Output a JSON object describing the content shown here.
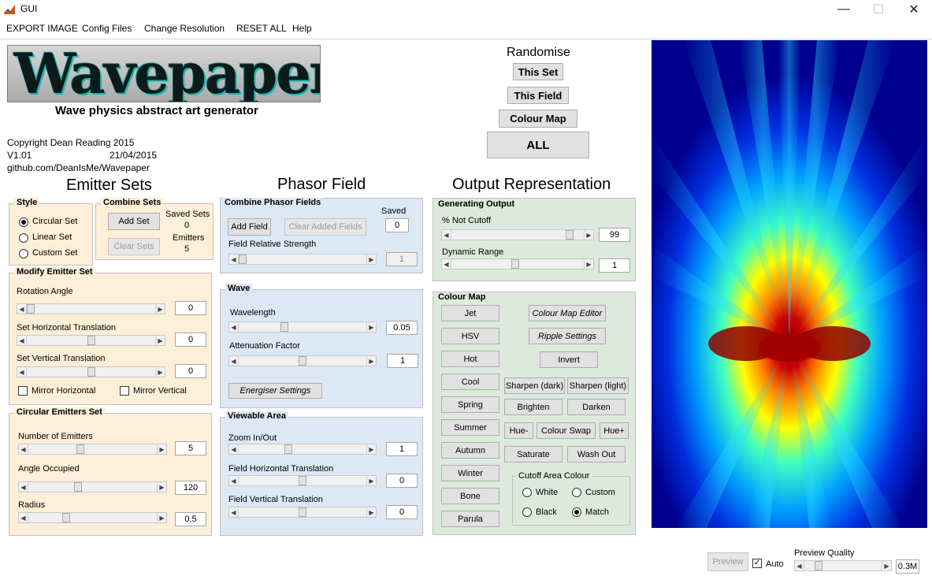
{
  "window": {
    "title": "GUI",
    "minimize": "—",
    "maximize": "☐",
    "close": "✕"
  },
  "menu": [
    "EXPORT IMAGE",
    "Config Files",
    "Change Resolution",
    "RESET ALL",
    "Help"
  ],
  "header": {
    "logo_text": "Wavepaper",
    "subtitle": "Wave physics abstract art generator",
    "copyright": "Copyright Dean Reading 2015",
    "version": "V1.01",
    "date": "21/04/2015",
    "url": "github.com/DeanIsMe/Wavepaper"
  },
  "randomise": {
    "title": "Randomise",
    "this_set": "This Set",
    "this_field": "This Field",
    "colour_map": "Colour Map",
    "all": "ALL"
  },
  "emitter": {
    "heading": "Emitter Sets",
    "style": {
      "title": "Style",
      "options": [
        "Circular Set",
        "Linear Set",
        "Custom Set"
      ],
      "selected": 0
    },
    "combine": {
      "title": "Combine Sets",
      "add_set": "Add Set",
      "clear_sets": "Clear Sets",
      "saved_label": "Saved Sets",
      "saved_value": "0",
      "emitters_label": "Emitters",
      "emitters_value": "5"
    },
    "modify": {
      "title": "Modify Emitter Set",
      "rotation_label": "Rotation Angle",
      "rotation_value": "0",
      "rotation_pos": 0.0,
      "htrans_label": "Set Horizontal Translation",
      "htrans_value": "0",
      "htrans_pos": 0.5,
      "vtrans_label": "Set Vertical Translation",
      "vtrans_value": "0",
      "vtrans_pos": 0.5,
      "mirror_h": "Mirror Horizontal",
      "mirror_v": "Mirror Vertical"
    },
    "circular": {
      "title": "Circular Emitters Set",
      "num_label": "Number of Emitters",
      "num_value": "5",
      "num_pos": 0.4,
      "angle_label": "Angle Occupied",
      "angle_value": "120",
      "angle_pos": 0.38,
      "radius_label": "Radius",
      "radius_value": "0.5",
      "radius_pos": 0.28
    }
  },
  "phasor": {
    "heading": "Phasor Field",
    "combine": {
      "title": "Combine Phasor Fields",
      "add_field": "Add Field",
      "clear_added": "Clear Added Fields",
      "saved_label": "Saved",
      "saved_value": "0",
      "strength_label": "Field Relative Strength",
      "strength_value": "1",
      "strength_pos": 0.0
    },
    "wave": {
      "title": "Wave",
      "wavelength_label": "Wavelength",
      "wavelength_value": "0.05",
      "wavelength_pos": 0.35,
      "attenuation_label": "Attenuation Factor",
      "attenuation_value": "1",
      "attenuation_pos": 0.5,
      "energiser": "Energiser Settings"
    },
    "viewable": {
      "title": "Viewable Area",
      "zoom_label": "Zoom In/Out",
      "zoom_value": "1",
      "zoom_pos": 0.38,
      "fh_label": "Field Horizontal Translation",
      "fh_value": "0",
      "fh_pos": 0.5,
      "fv_label": "Field Vertical Translation",
      "fv_value": "0",
      "fv_pos": 0.5
    }
  },
  "output": {
    "heading": "Output Representation",
    "generating": {
      "title": "Generating Output",
      "cutoff_label": "% Not Cutoff",
      "cutoff_value": "99",
      "cutoff_pos": 0.92,
      "range_label": "Dynamic Range",
      "range_value": "1",
      "range_pos": 0.48
    },
    "colourmap": {
      "title": "Colour Map",
      "maps": [
        "Jet",
        "HSV",
        "Hot",
        "Cool",
        "Spring",
        "Summer",
        "Autumn",
        "Winter",
        "Bone",
        "Parula"
      ],
      "editor": "Colour Map Editor",
      "ripple": "Ripple Settings",
      "invert": "Invert",
      "sharpen_dark": "Sharpen (dark)",
      "sharpen_light": "Sharpen (light)",
      "brighten": "Brighten",
      "darken": "Darken",
      "hue_minus": "Hue-",
      "colour_swap": "Colour Swap",
      "hue_plus": "Hue+",
      "saturate": "Saturate",
      "wash_out": "Wash Out",
      "cutoff": {
        "title": "Cutoff Area Colour",
        "white": "White",
        "custom": "Custom",
        "black": "Black",
        "match": "Match",
        "selected": "match"
      }
    }
  },
  "footer": {
    "preview": "Preview",
    "auto": "Auto",
    "auto_checked": true,
    "quality_label": "Preview Quality",
    "quality_value": "0.3M",
    "quality_pos": 0.15
  },
  "colors": {
    "panel_orange": "#fdefd8",
    "panel_blue": "#dde8f5",
    "panel_green": "#dde9dc",
    "jet_low": "#00008f",
    "jet_high": "#800000"
  }
}
